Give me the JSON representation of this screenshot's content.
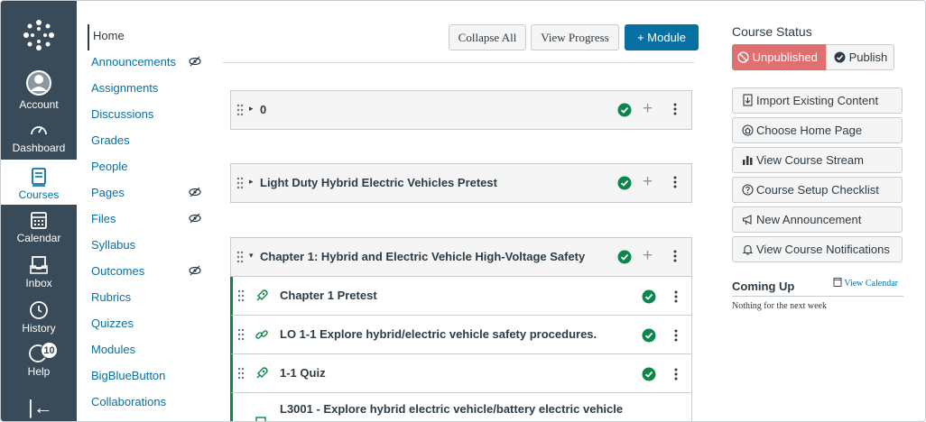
{
  "global_nav": {
    "account": "Account",
    "dashboard": "Dashboard",
    "courses": "Courses",
    "calendar": "Calendar",
    "inbox": "Inbox",
    "history": "History",
    "help": "Help",
    "help_badge": "10",
    "collapse_glyph": "|←"
  },
  "course_nav": {
    "items": [
      {
        "label": "Home"
      },
      {
        "label": "Announcements"
      },
      {
        "label": "Assignments"
      },
      {
        "label": "Discussions"
      },
      {
        "label": "Grades"
      },
      {
        "label": "People"
      },
      {
        "label": "Pages"
      },
      {
        "label": "Files"
      },
      {
        "label": "Syllabus"
      },
      {
        "label": "Outcomes"
      },
      {
        "label": "Rubrics"
      },
      {
        "label": "Quizzes"
      },
      {
        "label": "Modules"
      },
      {
        "label": "BigBlueButton"
      },
      {
        "label": "Collaborations"
      }
    ]
  },
  "toolbar": {
    "collapse_all": "Collapse All",
    "view_progress": "View Progress",
    "add_module": "+ Module"
  },
  "modules": [
    {
      "title": "0",
      "expanded": false
    },
    {
      "title": "Light Duty Hybrid Electric Vehicles Pretest",
      "expanded": false
    },
    {
      "title": "Chapter 1: Hybrid and Electric Vehicle High-Voltage Safety",
      "expanded": true
    }
  ],
  "module_items": [
    {
      "title": "Chapter 1 Pretest",
      "type": "quiz-rocket-icon"
    },
    {
      "title": "LO 1-1 Explore hybrid/electric vehicle safety procedures.",
      "type": "link-icon"
    },
    {
      "title": "1-1 Quiz",
      "type": "quiz-rocket-icon"
    },
    {
      "title": "L3001 - Explore hybrid electric vehicle/battery electric vehicle",
      "type": "page-icon"
    }
  ],
  "sidebar": {
    "course_status": "Course Status",
    "unpublished": "Unpublished",
    "publish": "Publish",
    "buttons": [
      "Import Existing Content",
      "Choose Home Page",
      "View Course Stream",
      "Course Setup Checklist",
      "New Announcement",
      "View Course Notifications"
    ],
    "coming_up": "Coming Up",
    "view_calendar": "View Calendar",
    "nothing": "Nothing for the next week"
  },
  "colors": {
    "nav_bg": "#394b58",
    "link": "#0770a3",
    "primary": "#0770a3",
    "published_green": "#0b874b",
    "unpublished_red": "#e06f6f"
  }
}
